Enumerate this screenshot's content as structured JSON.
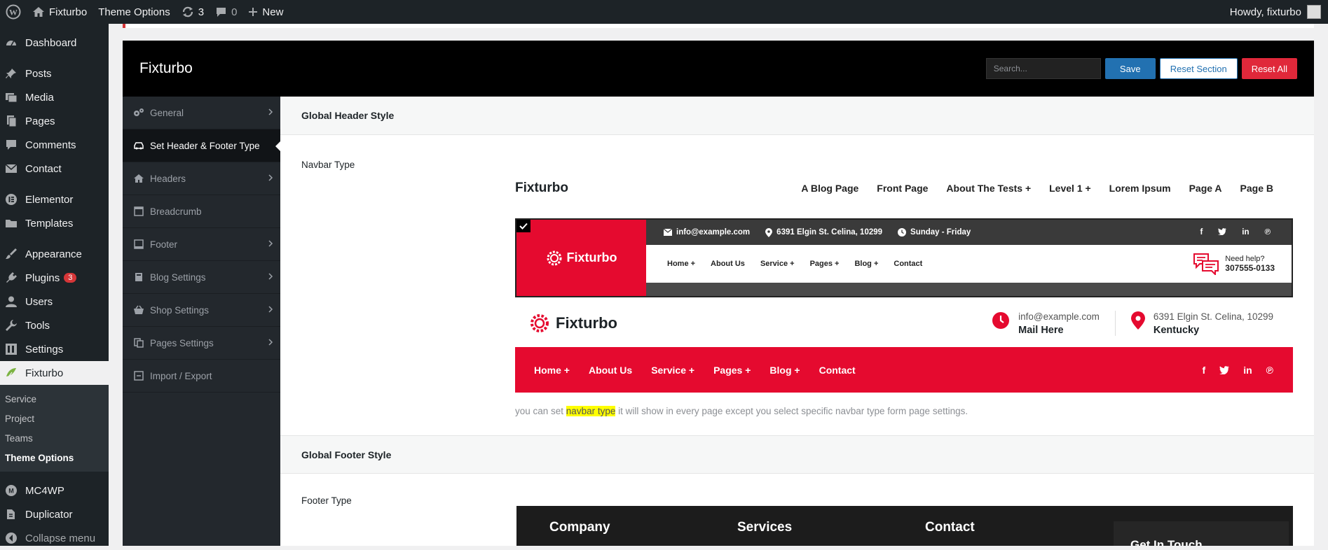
{
  "adminbar": {
    "site_name": "Fixturbo",
    "theme_options": "Theme Options",
    "updates_count": "3",
    "comments_count": "0",
    "new_label": "New",
    "howdy": "Howdy, fixturbo"
  },
  "menu": {
    "items": [
      {
        "label": "Dashboard",
        "icon": "dashboard-icon"
      },
      {
        "label": "Posts",
        "icon": "pin-icon"
      },
      {
        "label": "Media",
        "icon": "media-icon"
      },
      {
        "label": "Pages",
        "icon": "pages-icon"
      },
      {
        "label": "Comments",
        "icon": "comment-icon"
      },
      {
        "label": "Contact",
        "icon": "mail-icon"
      },
      {
        "label": "Elementor",
        "icon": "elementor-icon"
      },
      {
        "label": "Templates",
        "icon": "folder-icon"
      },
      {
        "label": "Appearance",
        "icon": "brush-icon"
      },
      {
        "label": "Plugins",
        "icon": "plug-icon",
        "badge": "3"
      },
      {
        "label": "Users",
        "icon": "user-icon"
      },
      {
        "label": "Tools",
        "icon": "wrench-icon"
      },
      {
        "label": "Settings",
        "icon": "settings-icon"
      },
      {
        "label": "Fixturbo",
        "icon": "fixturbo-icon"
      }
    ],
    "submenu": [
      "Service",
      "Project",
      "Teams",
      "Theme Options"
    ],
    "after": [
      {
        "label": "MC4WP",
        "icon": "mc4wp-icon"
      },
      {
        "label": "Duplicator",
        "icon": "duplicator-icon"
      },
      {
        "label": "Collapse menu",
        "icon": "collapse-icon"
      }
    ]
  },
  "panel": {
    "title": "Fixturbo",
    "search_placeholder": "Search...",
    "save": "Save",
    "reset_section": "Reset Section",
    "reset_all": "Reset All",
    "nav": [
      {
        "label": "General",
        "icon": "gears-icon"
      },
      {
        "label": "Set Header & Footer Type",
        "icon": "car-icon"
      },
      {
        "label": "Headers",
        "icon": "home-icon"
      },
      {
        "label": "Breadcrumb",
        "icon": "breadcrumb-icon"
      },
      {
        "label": "Footer",
        "icon": "footer-icon"
      },
      {
        "label": "Blog Settings",
        "icon": "book-icon"
      },
      {
        "label": "Shop Settings",
        "icon": "basket-icon"
      },
      {
        "label": "Pages Settings",
        "icon": "copy-icon"
      },
      {
        "label": "Import / Export",
        "icon": "import-icon"
      }
    ]
  },
  "main": {
    "header_section_title": "Global Header Style",
    "navbar_type_label": "Navbar Type",
    "nav1": {
      "logo": "Fixturbo",
      "links": [
        "A Blog Page",
        "Front Page",
        "About The Tests +",
        "Level 1 +",
        "Lorem Ipsum",
        "Page A",
        "Page B"
      ]
    },
    "nav2": {
      "logo": "Fixturbo",
      "email": "info@example.com",
      "address": "6391 Elgin St. Celina, 10299",
      "hours": "Sunday - Friday",
      "menu": [
        "Home +",
        "About Us",
        "Service +",
        "Pages +",
        "Blog +",
        "Contact"
      ],
      "help_title": "Need help?",
      "help_phone": "307555-0133"
    },
    "nav3": {
      "logo": "Fixturbo",
      "email": "info@example.com",
      "email_sub": "Mail Here",
      "address": "6391 Elgin St. Celina, 10299",
      "address_sub": "Kentucky",
      "menu": [
        "Home +",
        "About Us",
        "Service +",
        "Pages +",
        "Blog +",
        "Contact"
      ]
    },
    "help_text_before": "you can set ",
    "help_text_highlight": "navbar type",
    "help_text_after": " it will show in every page except you select specific navbar type form page settings.",
    "footer_section_title": "Global Footer Style",
    "footer_type_label": "Footer Type",
    "footer_preview": {
      "col1": "Company",
      "col2": "Services",
      "col3": "Contact",
      "get_in_touch": "Get In Touch"
    }
  },
  "colors": {
    "accent_red": "#e50a2f",
    "wp_blue": "#2271b1",
    "admin_dark": "#1d2327"
  }
}
